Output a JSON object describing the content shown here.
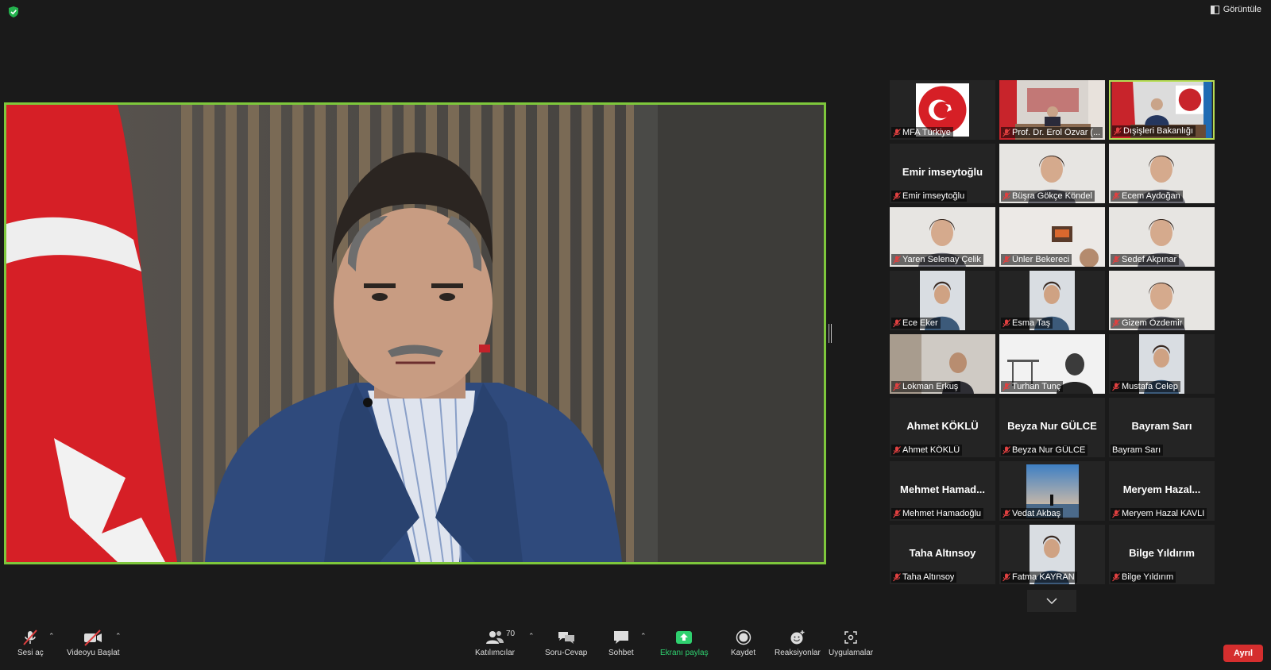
{
  "view_button": {
    "label": "Görüntüle"
  },
  "participants": [
    {
      "name": "MFA Türkiye",
      "display": "",
      "kind": "flag-seal",
      "muted": true,
      "active": false
    },
    {
      "name": "Prof. Dr. Erol Özvar (...",
      "display": "",
      "kind": "office",
      "muted": true,
      "active": false
    },
    {
      "name": "Dışişleri Bakanlığı",
      "display": "",
      "kind": "office-seal",
      "muted": true,
      "active": true
    },
    {
      "name": "Emir imseytoğlu",
      "display": "Emir imseytoğlu",
      "kind": "none",
      "muted": true,
      "active": false
    },
    {
      "name": "Büşra Gökçe Köndel",
      "display": "",
      "kind": "person-light",
      "muted": true,
      "active": false
    },
    {
      "name": "Ecem Aydoğan",
      "display": "",
      "kind": "person-light",
      "muted": true,
      "active": false
    },
    {
      "name": "Yaren Selenay Çelik",
      "display": "",
      "kind": "person-light",
      "muted": true,
      "active": false
    },
    {
      "name": "Ünler Bekereci",
      "display": "",
      "kind": "room",
      "muted": true,
      "active": false
    },
    {
      "name": "Sedef Akpınar",
      "display": "",
      "kind": "person-light",
      "muted": true,
      "active": false
    },
    {
      "name": "Ece Eker",
      "display": "",
      "kind": "portrait-narrow",
      "muted": true,
      "active": false
    },
    {
      "name": "Esma Taş",
      "display": "",
      "kind": "portrait-narrow",
      "muted": true,
      "active": false
    },
    {
      "name": "Gizem Özdemir",
      "display": "",
      "kind": "person-light",
      "muted": true,
      "active": false
    },
    {
      "name": "Lokman Erkuş",
      "display": "",
      "kind": "person-dark",
      "muted": true,
      "active": false
    },
    {
      "name": "Turhan Tunç",
      "display": "",
      "kind": "backlit",
      "muted": true,
      "active": false
    },
    {
      "name": "Mustafa Celep",
      "display": "",
      "kind": "portrait-narrow",
      "muted": true,
      "active": false
    },
    {
      "name": "Ahmet KÖKLÜ",
      "display": "Ahmet KÖKLÜ",
      "kind": "none",
      "muted": true,
      "active": false
    },
    {
      "name": "Beyza Nur GÜLCE",
      "display": "Beyza Nur GÜLCE",
      "kind": "none",
      "muted": true,
      "active": false
    },
    {
      "name": "Bayram Sarı",
      "display": "Bayram Sarı",
      "kind": "none",
      "muted": false,
      "active": false
    },
    {
      "name": "Mehmet Hamadoğlu",
      "display": "Mehmet Hamad...",
      "kind": "none",
      "muted": true,
      "active": false
    },
    {
      "name": "Vedat Akbaş",
      "display": "",
      "kind": "sky",
      "muted": true,
      "active": false
    },
    {
      "name": "Meryem Hazal KAVLI",
      "display": "Meryem Hazal...",
      "kind": "none",
      "muted": true,
      "active": false
    },
    {
      "name": "Taha Altınsoy",
      "display": "Taha Altınsoy",
      "kind": "none",
      "muted": true,
      "active": false
    },
    {
      "name": "Fatma KAYRAN",
      "display": "",
      "kind": "portrait-narrow",
      "muted": true,
      "active": false
    },
    {
      "name": "Bilge Yıldırım",
      "display": "Bilge Yıldırım",
      "kind": "none",
      "muted": true,
      "active": false
    }
  ],
  "toolbar": {
    "mute": "Sesi aç",
    "video": "Videoyu Başlat",
    "participants": "Katılımcılar",
    "participant_count": "70",
    "qa": "Soru-Cevap",
    "chat": "Sohbet",
    "share": "Ekranı paylaş",
    "record": "Kaydet",
    "reactions": "Reaksiyonlar",
    "apps": "Uygulamalar",
    "leave": "Ayrıl"
  },
  "colors": {
    "active_speaker_border": "#7ec73c",
    "share_green": "#2fd06f",
    "leave_red": "#d52e2e",
    "muted_red": "#e04040",
    "background": "#1a1a1a"
  }
}
